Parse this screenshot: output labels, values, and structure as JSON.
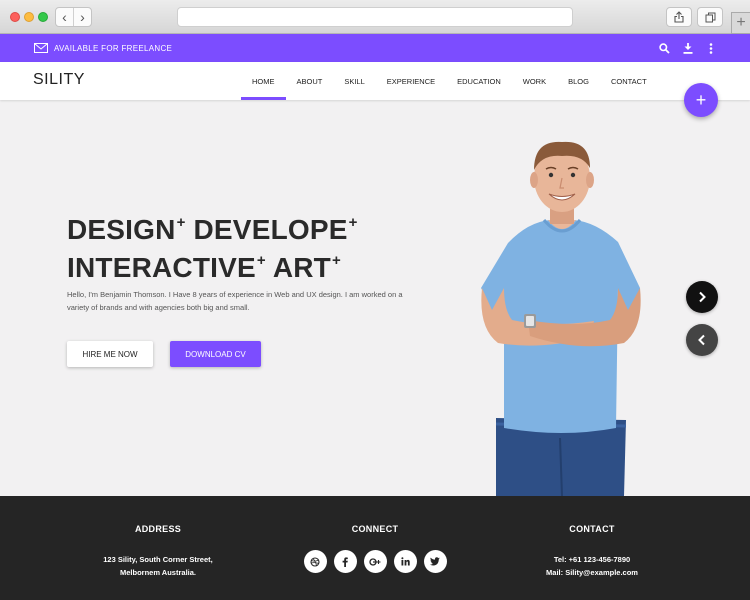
{
  "topbar": {
    "freelance_label": "AVAILABLE FOR FREELANCE",
    "icons": [
      "search-icon",
      "download-icon",
      "more-vertical-icon"
    ]
  },
  "header": {
    "logo": "SILITY",
    "menu": [
      {
        "label": "HOME",
        "active": true
      },
      {
        "label": "ABOUT"
      },
      {
        "label": "SKILL"
      },
      {
        "label": "EXPERIENCE"
      },
      {
        "label": "EDUCATION"
      },
      {
        "label": "WORK"
      },
      {
        "label": "BLOG"
      },
      {
        "label": "CONTACT"
      }
    ],
    "fab_icon": "+"
  },
  "hero": {
    "line1_a": "DESIGN",
    "line1_b": "DEVELOPE",
    "line2_a": "INTERACTIVE",
    "line2_b": "ART",
    "sup": "+",
    "intro": "Hello, I'm Benjamin Thomson. I Have 8 years of experience in Web and UX design. I am worked on a variety of brands and with agencies both big and small.",
    "hire_button": "HIRE ME NOW",
    "cv_button": "DOWNLOAD CV"
  },
  "footer": {
    "address": {
      "title": "ADDRESS",
      "line1": "123 Sility, South Corner Street,",
      "line2": "Melbornem Australia."
    },
    "connect": {
      "title": "CONNECT",
      "social": [
        "dribbble-icon",
        "facebook-icon",
        "google-plus-icon",
        "linkedin-icon",
        "twitter-icon"
      ]
    },
    "contact": {
      "title": "CONTACT",
      "tel": "Tel: +61 123-456-7890",
      "mail": "Mail: Sility@example.com"
    }
  },
  "colors": {
    "accent": "#7c4dff",
    "footer_bg": "#252525",
    "hero_bg": "#f2f1f2"
  }
}
